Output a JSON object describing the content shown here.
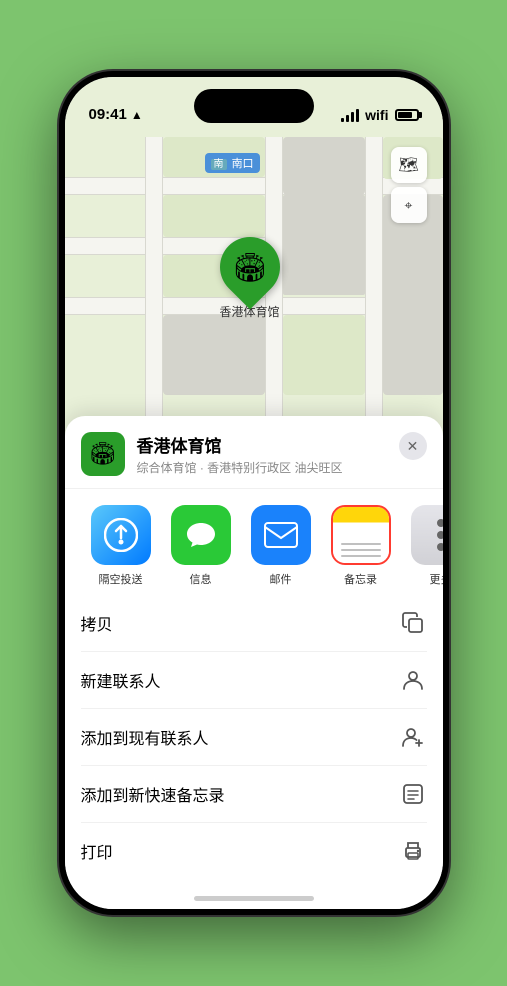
{
  "status": {
    "time": "09:41",
    "location_icon": "▲"
  },
  "map": {
    "label": "南口",
    "label_prefix": "南"
  },
  "venue": {
    "name": "香港体育馆",
    "subtitle": "综合体育馆 · 香港特别行政区 油尖旺区",
    "pin_label": "香港体育馆"
  },
  "share_items": [
    {
      "id": "airdrop",
      "label": "隔空投送",
      "type": "airdrop"
    },
    {
      "id": "messages",
      "label": "信息",
      "type": "messages"
    },
    {
      "id": "mail",
      "label": "邮件",
      "type": "mail"
    },
    {
      "id": "notes",
      "label": "备忘录",
      "type": "notes"
    },
    {
      "id": "more",
      "label": "更多",
      "type": "more"
    }
  ],
  "actions": [
    {
      "id": "copy",
      "label": "拷贝",
      "icon": "copy"
    },
    {
      "id": "new-contact",
      "label": "新建联系人",
      "icon": "person"
    },
    {
      "id": "add-contact",
      "label": "添加到现有联系人",
      "icon": "person-add"
    },
    {
      "id": "quick-note",
      "label": "添加到新快速备忘录",
      "icon": "note"
    },
    {
      "id": "print",
      "label": "打印",
      "icon": "print"
    }
  ],
  "controls": {
    "map_icon": "🗺",
    "location_icon": "⌖"
  }
}
